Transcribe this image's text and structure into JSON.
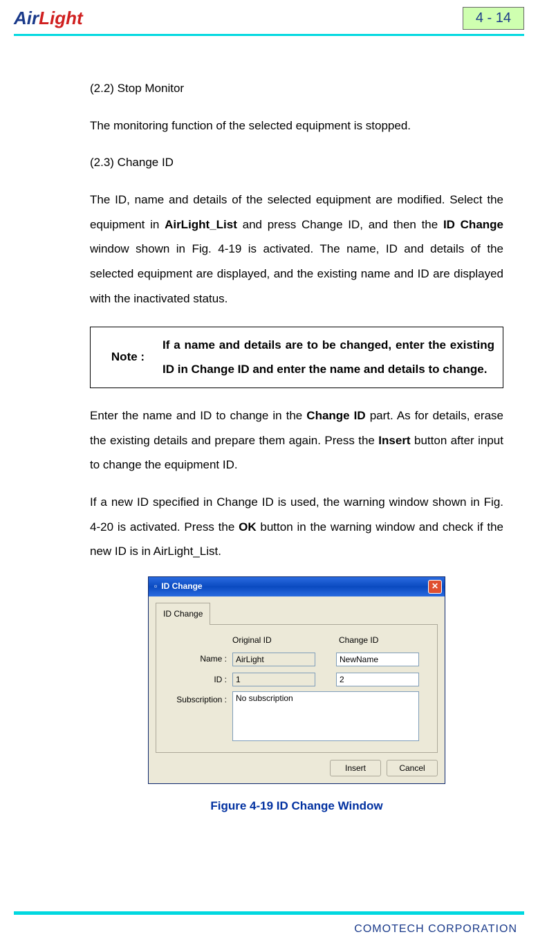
{
  "header": {
    "logo_air": "Air",
    "logo_light": "Light",
    "page_num": "4 - 14"
  },
  "sections": {
    "s22_heading": "(2.2) Stop Monitor",
    "s22_text": "The monitoring function of the selected equipment is stopped.",
    "s23_heading": "(2.3) Change ID",
    "s23_p1_a": "The ID, name and details of the selected equipment are modified. Select the equipment in ",
    "s23_p1_b": "AirLight_List",
    "s23_p1_c": " and press Change ID, and then the ",
    "s23_p1_d": "ID Change",
    "s23_p1_e": " window shown in Fig. 4-19 is activated. The name, ID and details of the selected equipment are displayed, and the existing name and ID are displayed with the inactivated status."
  },
  "note": {
    "label": "Note :",
    "text": "If a name and details are to be changed, enter the existing ID in Change ID and enter the name and details to change."
  },
  "body2": {
    "p1_a": "Enter the name and ID to change in the ",
    "p1_b": "Change ID",
    "p1_c": " part. As for details, erase the existing details and prepare them again. Press the ",
    "p1_d": "Insert",
    "p1_e": " button after input to change the equipment ID.",
    "p2_a": " If a new ID specified in Change ID is used, the warning window shown in Fig. 4-20 is activated. Press the ",
    "p2_b": "OK",
    "p2_c": " button in the warning window and check if the new ID is in AirLight_List."
  },
  "dialog": {
    "title": "ID Change",
    "tab": "ID Change",
    "col_original": "Original ID",
    "col_change": "Change ID",
    "label_name": "Name :",
    "label_id": "ID :",
    "label_sub": "Subscription :",
    "val_orig_name": "AirLight",
    "val_orig_id": "1",
    "val_change_name": "NewName",
    "val_change_id": "2",
    "val_sub": "No subscription",
    "btn_insert": "Insert",
    "btn_cancel": "Cancel"
  },
  "caption": "Figure 4-19 ID Change Window",
  "footer": "COMOTECH CORPORATION"
}
